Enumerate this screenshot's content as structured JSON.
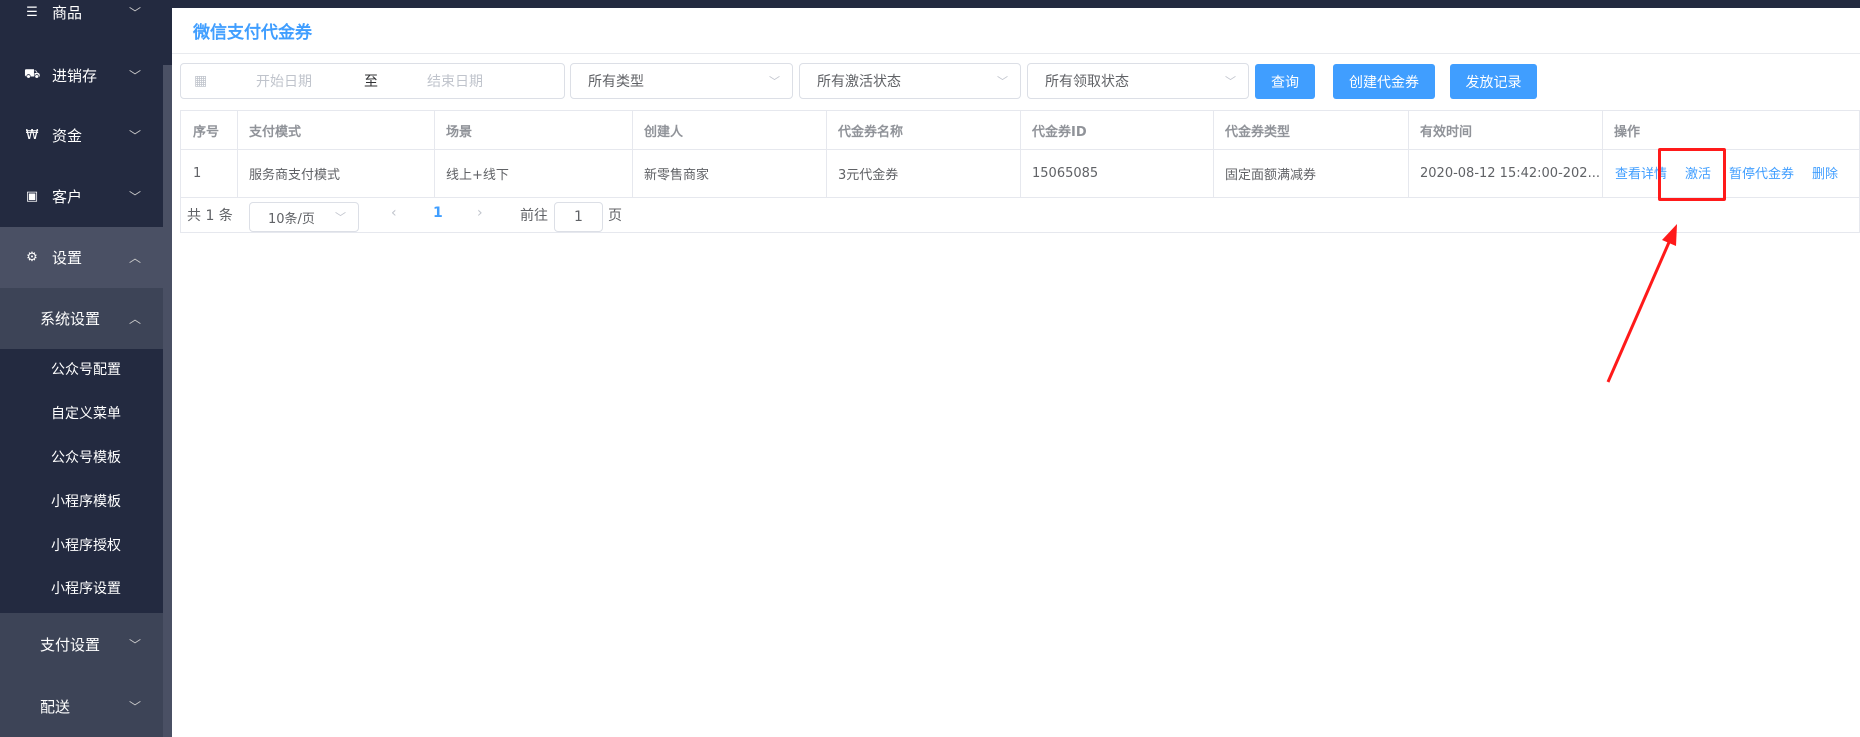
{
  "sidebar": {
    "items": [
      {
        "label": "商品",
        "icon": "list-icon"
      },
      {
        "label": "进销存",
        "icon": "truck-icon"
      },
      {
        "label": "资金",
        "icon": "won-icon"
      },
      {
        "label": "客户",
        "icon": "id-card-icon"
      },
      {
        "label": "设置",
        "icon": "gear-icon"
      }
    ],
    "system_settings": "系统设置",
    "sub_items": [
      "公众号配置",
      "自定义菜单",
      "公众号模板",
      "小程序模板",
      "小程序授权",
      "小程序设置"
    ],
    "pay_settings": "支付设置",
    "delivery": "配送"
  },
  "page": {
    "title": "微信支付代金券"
  },
  "filters": {
    "start_placeholder": "开始日期",
    "range_sep": "至",
    "end_placeholder": "结束日期",
    "type": "所有类型",
    "activation": "所有激活状态",
    "claim": "所有领取状态",
    "query": "查询",
    "create": "创建代金券",
    "records": "发放记录"
  },
  "table": {
    "headers": [
      "序号",
      "支付模式",
      "场景",
      "创建人",
      "代金券名称",
      "代金券ID",
      "代金券类型",
      "有效时间",
      "操作"
    ],
    "rows": [
      {
        "cells": [
          "1",
          "服务商支付模式",
          "线上+线下",
          "新零售商家",
          "3元代金券",
          "15065085",
          "固定面额满减券",
          "2020-08-12 15:42:00-202..."
        ],
        "actions": [
          "查看详情",
          "激活",
          "暂停代金券",
          "删除"
        ]
      }
    ]
  },
  "pagination": {
    "total": "共 1 条",
    "page_size": "10条/页",
    "current": "1",
    "goto": "前往",
    "goto_value": "1",
    "page_unit": "页"
  },
  "colors": {
    "accent": "#409eff",
    "sidebar": "#232a40",
    "annotation": "#ff1a1a"
  }
}
